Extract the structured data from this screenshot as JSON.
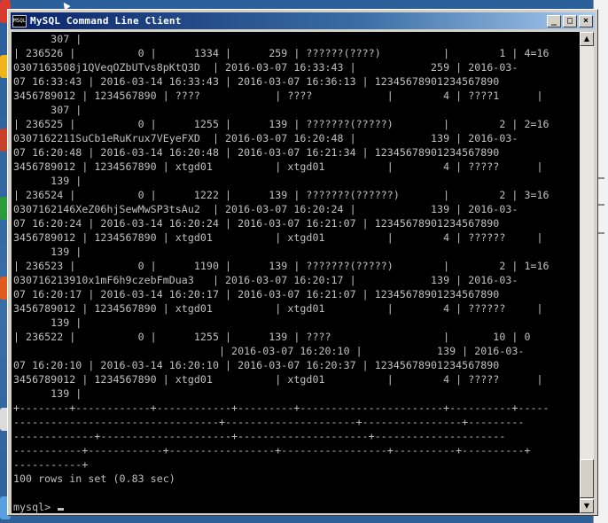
{
  "window": {
    "title": "MySQL Command Line Client",
    "app_icon_text": "MSQL",
    "buttons": {
      "minimize": "_",
      "maximize": "□",
      "close": "×"
    }
  },
  "console": {
    "lines": [
      "      307 |",
      "| 236526 |          0 |      1334 |      259 | ??????(????)          |        1 | 4=16",
      "0307163508j1QVeqOZbUTvs8pKtQ3D  | 2016-03-07 16:33:43 |            259 | 2016-03-",
      "07 16:33:43 | 2016-03-14 16:33:43 | 2016-03-07 16:36:13 | 12345678901234567890",
      "3456789012 | 1234567890 | ????            | ????            |        4 | ????1      |",
      "      307 |",
      "| 236525 |          0 |      1255 |      139 | ???????(?????)        |        2 | 2=16",
      "0307162211SuCb1eRuKrux7VEyeFXD  | 2016-03-07 16:20:48 |            139 | 2016-03-",
      "07 16:20:48 | 2016-03-14 16:20:48 | 2016-03-07 16:21:34 | 12345678901234567890",
      "3456789012 | 1234567890 | xtgd01          | xtgd01          |        4 | ?????      |",
      "      139 |",
      "| 236524 |          0 |      1222 |      139 | ???????(??????)       |        2 | 3=16",
      "0307162146XeZ06hjSewMwSP3tsAu2  | 2016-03-07 16:20:24 |            139 | 2016-03-",
      "07 16:20:24 | 2016-03-14 16:20:24 | 2016-03-07 16:21:07 | 12345678901234567890",
      "3456789012 | 1234567890 | xtgd01          | xtgd01          |        4 | ??????     |",
      "      139 |",
      "| 236523 |          0 |      1190 |      139 | ???????(?????)        |        2 | 1=16",
      "030716213910x1mF6h9czebFmDua3   | 2016-03-07 16:20:17 |            139 | 2016-03-",
      "07 16:20:17 | 2016-03-14 16:20:17 | 2016-03-07 16:21:07 | 12345678901234567890",
      "3456789012 | 1234567890 | xtgd01          | xtgd01          |        4 | ??????     |",
      "      139 |",
      "| 236522 |          0 |      1255 |      139 | ????                  |       10 | 0",
      "                                 | 2016-03-07 16:20:10 |            139 | 2016-03-",
      "07 16:20:10 | 2016-03-14 16:20:10 | 2016-03-07 16:20:37 | 12345678901234567890",
      "3456789012 | 1234567890 | xtgd01          | xtgd01          |        4 | ?????      |",
      "      139 |",
      "+--------+------------+------------+---------+-----------------------+----------+-----",
      "---------------------------------+---------------------+----------------+---------",
      "-------------+---------------------+---------------------+---------------------",
      "-----------+------------+-----------------+-----------------+----------+----------+",
      "-----------+",
      "100 rows in set (0.83 sec)",
      "",
      "mysql> "
    ]
  },
  "colors": {
    "console_bg": "#000000",
    "console_fg": "#c0c0c0",
    "titlebar_start": "#0a246a",
    "titlebar_end": "#a6caf0",
    "chrome": "#d4d0c8"
  },
  "icons": {
    "app": "console-icon",
    "scroll_up": "arrow-up-icon",
    "scroll_down": "arrow-down-icon"
  }
}
